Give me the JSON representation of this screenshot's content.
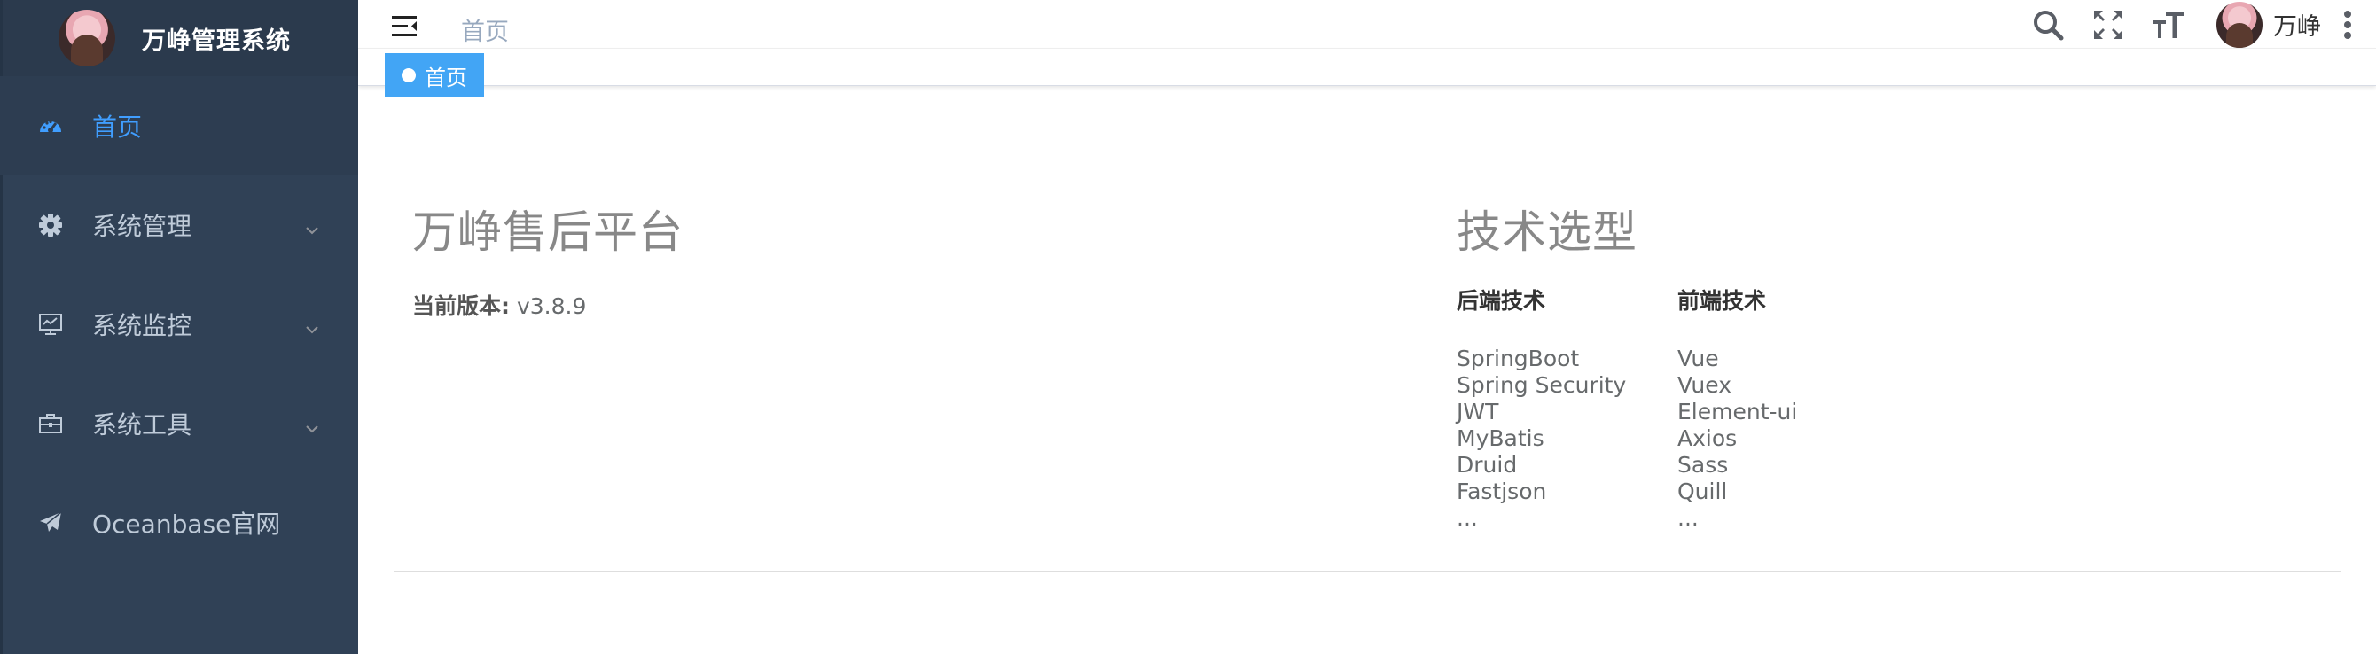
{
  "sidebar": {
    "title": "万峥管理系统",
    "items": [
      {
        "label": "首页",
        "icon": "dashboard-icon",
        "active": true
      },
      {
        "label": "系统管理",
        "icon": "gear-icon"
      },
      {
        "label": "系统监控",
        "icon": "monitor-icon"
      },
      {
        "label": "系统工具",
        "icon": "toolbox-icon"
      },
      {
        "label": "Oceanbase官网",
        "icon": "paper-plane-icon"
      }
    ]
  },
  "header": {
    "breadcrumb": "首页",
    "user_name": "万峥",
    "icons": [
      "search-icon",
      "fullscreen-icon",
      "font-size-icon",
      "more-vertical-icon"
    ]
  },
  "tags": [
    {
      "label": "首页",
      "active": true
    }
  ],
  "main": {
    "title_left": "万峥售后平台",
    "version_label": "当前版本:",
    "version_value": "v3.8.9",
    "title_right": "技术选型",
    "backend": {
      "heading": "后端技术",
      "items": [
        "SpringBoot",
        "Spring Security",
        "JWT",
        "MyBatis",
        "Druid",
        "Fastjson",
        "..."
      ]
    },
    "frontend": {
      "heading": "前端技术",
      "items": [
        "Vue",
        "Vuex",
        "Element-ui",
        "Axios",
        "Sass",
        "Quill",
        "..."
      ]
    }
  },
  "colors": {
    "sidebar_bg": "#304156",
    "accent": "#409eff",
    "tag_bg": "#42a5f5"
  }
}
